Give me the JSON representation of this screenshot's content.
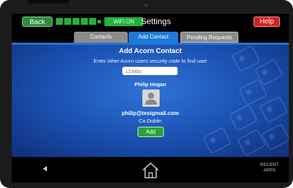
{
  "status_bar": {
    "back_label": "Back",
    "wifi_label": "WiFi ON",
    "title": "Settings",
    "help_label": "Help"
  },
  "tabs": [
    {
      "label": "Contacts",
      "active": false
    },
    {
      "label": "Add Contact",
      "active": true
    },
    {
      "label": "Pending Requests",
      "active": false
    }
  ],
  "add_contact": {
    "heading": "Add Acorn Contact",
    "instructions": "Enter other Acorn users security code to find user",
    "code_placeholder": "123abc",
    "user_name": "Philip Hogan",
    "user_email": "philip@testgmail.com",
    "user_location": "Co.Dublin",
    "add_label": "Add"
  },
  "nav_bar": {
    "recent_label": "RECENT APPS"
  },
  "colors": {
    "accent_blue": "#1e79d9",
    "green": "#22b33b",
    "red": "#d42020"
  }
}
